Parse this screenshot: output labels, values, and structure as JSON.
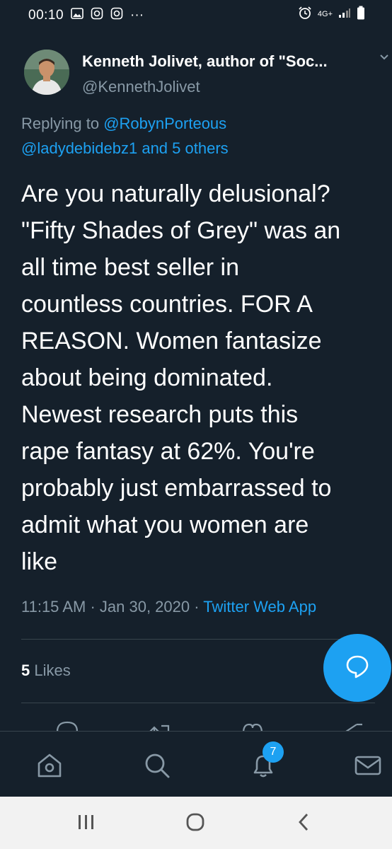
{
  "status_bar": {
    "time": "00:10",
    "dots": "···",
    "network": "4G+",
    "icons": [
      "image-icon",
      "instagram-icon",
      "instagram-icon",
      "alarm-icon",
      "signal-icon",
      "battery-icon"
    ]
  },
  "tweet": {
    "author_name": "Kenneth Jolivet, author of \"Soc...",
    "author_handle": "@KennethJolivet",
    "replying_prefix": "Replying to ",
    "replying_to_1": "@RobynPorteous",
    "replying_line2": "@ladydebidebz1 and 5 others",
    "text_lines": [
      "Are you naturally delusional?",
      "\"Fifty Shades of Grey\" was an",
      "all time best seller in",
      "countless countries. FOR A",
      "REASON. Women fantasize",
      "about being dominated.",
      "Newest research puts this",
      "rape fantasy at 62%. You're",
      "probably just embarrassed to",
      "admit what you women are",
      "like"
    ],
    "time": "11:15 AM",
    "separator": " · ",
    "date": "Jan 30, 2020",
    "source": "Twitter Web App",
    "likes_count": "5",
    "likes_label": " Likes"
  },
  "bottom_nav": {
    "items": [
      "home-icon",
      "search-icon",
      "notifications-icon",
      "messages-icon"
    ],
    "notification_badge": "7"
  },
  "colors": {
    "background": "#15202b",
    "accent": "#1da1f2",
    "secondary_text": "#8899a6",
    "divider": "#38444d"
  }
}
